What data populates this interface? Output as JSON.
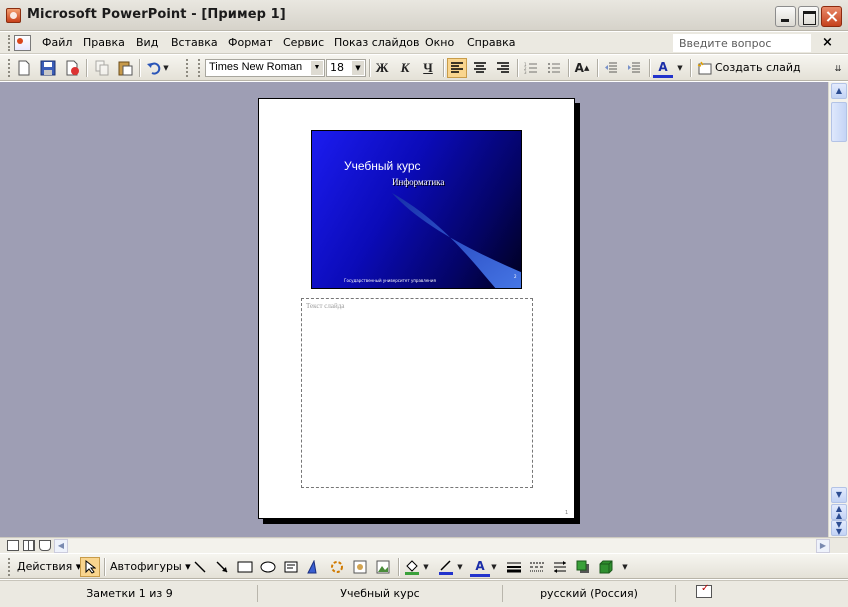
{
  "window": {
    "title": "Microsoft PowerPoint - [Пример 1]"
  },
  "menu": {
    "items": [
      {
        "label": "Файл"
      },
      {
        "label": "Правка"
      },
      {
        "label": "Вид"
      },
      {
        "label": "Вставка"
      },
      {
        "label": "Формат"
      },
      {
        "label": "Сервис"
      },
      {
        "label": "Показ слайдов"
      },
      {
        "label": "Окно"
      },
      {
        "label": "Справка"
      }
    ],
    "help_placeholder": "Введите вопрос",
    "help_close": "×"
  },
  "toolbar": {
    "font": "Times New Roman",
    "size": "18",
    "bold": "Ж",
    "italic": "К",
    "underline": "Ч",
    "new_slide": "Создать слайд"
  },
  "slide": {
    "title": "Учебный курс",
    "subtitle": "Информатика",
    "footer": "Государственный университет управления",
    "number": "2"
  },
  "notes": {
    "placeholder": "Текст слайда",
    "page_number": "1"
  },
  "drawing": {
    "actions": "Действия",
    "autoshapes": "Автофигуры"
  },
  "status": {
    "notes": "Заметки 1 из 9",
    "design": "Учебный курс",
    "language": "русский (Россия)"
  }
}
